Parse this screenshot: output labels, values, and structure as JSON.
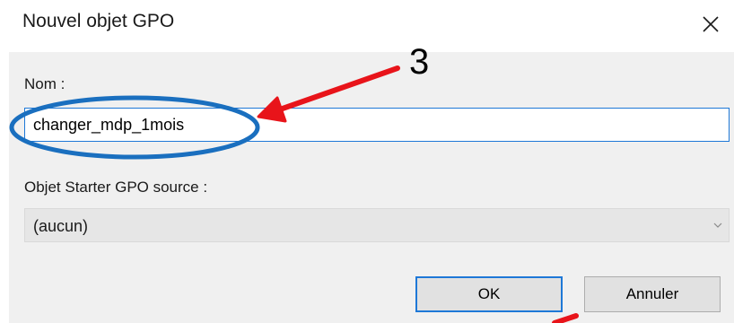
{
  "dialog": {
    "title": "Nouvel objet GPO",
    "close_icon": "close-icon"
  },
  "form": {
    "name_label": "Nom :",
    "name_value": "changer_mdp_1mois",
    "starter_label": "Objet Starter GPO source :",
    "starter_selected": "(aucun)",
    "dropdown_icon": "chevron-down-icon"
  },
  "buttons": {
    "ok_label": "OK",
    "cancel_label": "Annuler"
  },
  "annotation": {
    "step_number": "3",
    "highlight_color": "#1a6fbf",
    "arrow_color": "#e8141a"
  },
  "colors": {
    "accent": "#1e78d7",
    "client_background": "#f0f0f0"
  }
}
